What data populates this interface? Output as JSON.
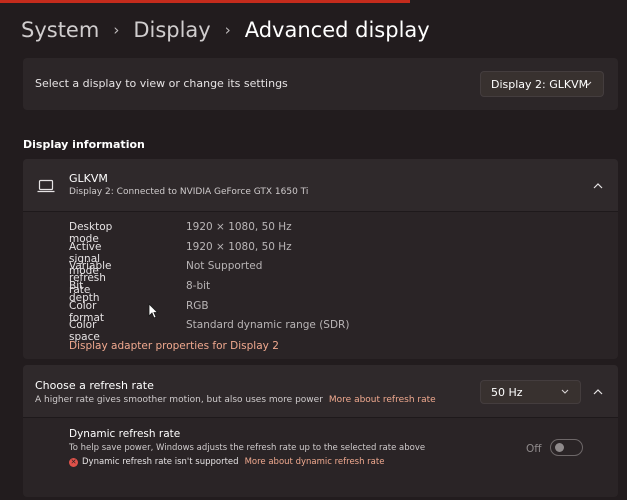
{
  "breadcrumb": {
    "items": [
      "System",
      "Display"
    ],
    "current": "Advanced display",
    "separator": "›"
  },
  "display_select": {
    "label": "Select a display to view or change its settings",
    "selected": "Display 2: GLKVM"
  },
  "display_info": {
    "heading": "Display information",
    "title": "GLKVM",
    "subtitle": "Display 2: Connected to NVIDIA GeForce GTX 1650 Ti",
    "properties": [
      {
        "label": "Desktop mode",
        "value": "1920 × 1080, 50 Hz"
      },
      {
        "label": "Active signal mode",
        "value": "1920 × 1080, 50 Hz"
      },
      {
        "label": "Variable refresh rate",
        "value": "Not Supported"
      },
      {
        "label": "Bit depth",
        "value": "8-bit"
      },
      {
        "label": "Color format",
        "value": "RGB"
      },
      {
        "label": "Color space",
        "value": "Standard dynamic range (SDR)"
      }
    ],
    "adapter_link": "Display adapter properties for Display 2"
  },
  "refresh": {
    "title": "Choose a refresh rate",
    "subtitle": "A higher rate gives smoother motion, but also uses more power",
    "more_link": "More about refresh rate",
    "selected": "50 Hz",
    "dynamic": {
      "title": "Dynamic refresh rate",
      "subtitle": "To help save power, Windows adjusts the refresh rate up to the selected rate above",
      "warning": "Dynamic refresh rate isn't supported",
      "warning_icon": "x-circle-icon",
      "more_link": "More about dynamic refresh rate",
      "toggle_label": "Off",
      "toggle_on": false
    }
  },
  "colors": {
    "background": "#221c1e",
    "card": "#2c2628",
    "accent_link": "#f0a98f",
    "error": "#e0524a",
    "window_accent": "#c42b1c"
  }
}
